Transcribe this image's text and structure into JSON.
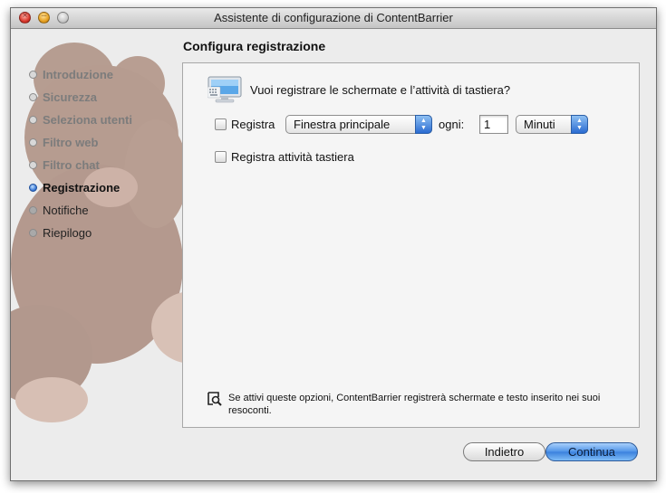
{
  "window": {
    "title": "Assistente di configurazione di ContentBarrier"
  },
  "page": {
    "title": "Configura registrazione"
  },
  "steps": [
    {
      "label": "Introduzione",
      "state": "done"
    },
    {
      "label": "Sicurezza",
      "state": "done"
    },
    {
      "label": "Seleziona utenti",
      "state": "done"
    },
    {
      "label": "Filtro web",
      "state": "done"
    },
    {
      "label": "Filtro chat",
      "state": "done"
    },
    {
      "label": "Registrazione",
      "state": "current"
    },
    {
      "label": "Notifiche",
      "state": "pending"
    },
    {
      "label": "Riepilogo",
      "state": "pending"
    }
  ],
  "panel": {
    "question": "Vuoi registrare le schermate e l’attività di tastiera?",
    "record_label": "Registra",
    "record_checked": false,
    "record_target": "Finestra principale",
    "every_label": "ogni:",
    "interval_value": "1",
    "interval_unit": "Minuti",
    "keyboard_label": "Registra attività tastiera",
    "keyboard_checked": false,
    "info_text": "Se attivi queste opzioni, ContentBarrier registrerà schermate e testo inserito nei suoi resoconti."
  },
  "buttons": {
    "back": "Indietro",
    "continue": "Continua"
  },
  "icons": {
    "close": "close-icon",
    "minimize": "minimize-icon",
    "zoom": "zoom-icon",
    "keyboard": "keyboard-monitor-icon",
    "info": "magnifier-info-icon"
  },
  "colors": {
    "accent": "#3a80dd",
    "window_bg": "#ececec"
  }
}
